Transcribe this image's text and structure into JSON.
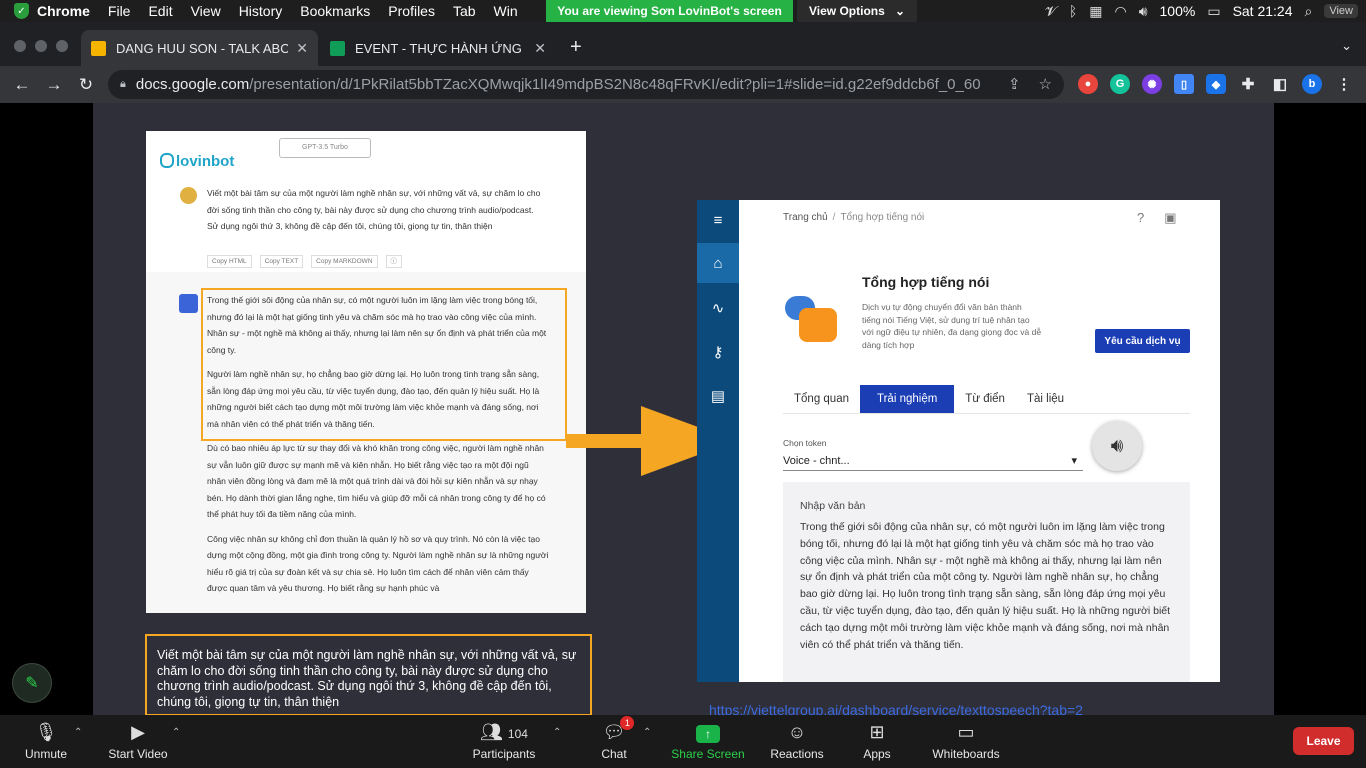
{
  "menubar": {
    "app": "Chrome",
    "items": [
      "File",
      "Edit",
      "View",
      "History",
      "Bookmarks",
      "Profiles",
      "Tab",
      "Win"
    ],
    "banner": "You are viewing Sơn LovinBot's screen",
    "view_options": "View Options",
    "battery": "100%",
    "clock": "Sat 21:24",
    "view": "View"
  },
  "tabs": [
    {
      "title": "DANG HUU SON - TALK ABOU",
      "favicon_color": "#f4b400"
    },
    {
      "title": "EVENT - THỰC HÀNH ỨNG DU",
      "favicon_color": "#0f9d58"
    }
  ],
  "toolbar": {
    "url_host": "docs.google.com",
    "url_path": "/presentation/d/1PkRilat5bbTZacXQMwqjk1lI49mdpBS2N8c48qFRvKI/edit?pli=1#slide=id.g22ef9ddcb6f_0_60"
  },
  "chat": {
    "model": "GPT-3.5 Turbo",
    "logo": "lovinbot",
    "prompt": "Viết một bài tâm sự của một người làm nghề nhân sự, với những vất vả, sự chăm lo cho đời sống tinh thần cho công ty, bài này được sử dụng cho chương trình audio/podcast. Sử dụng ngôi thứ 3, không đề cập đến tôi, chúng tôi, giọng tự tin, thân thiện",
    "copy_buttons": [
      "Copy HTML",
      "Copy TEXT",
      "Copy MARKDOWN"
    ],
    "answer": [
      "Trong thế giới sôi động của nhân sự, có một người luôn im lặng làm việc trong bóng tối, nhưng đó lại là một hạt giống tinh yêu và chăm sóc mà họ trao vào công việc của mình. Nhân sự - một nghề mà không ai thấy, nhưng lại làm nên sự ổn định và phát triển của một công ty.",
      "Người làm nghề nhân sự, họ chẳng bao giờ dừng lại. Họ luôn trong tình trạng sẵn sàng, sẵn lòng đáp ứng mọi yêu cầu, từ việc tuyển dụng, đào tạo, đến quản lý hiệu suất. Họ là những người biết cách tạo dựng một môi trường làm việc khỏe mạnh và đáng sống, nơi mà nhân viên có thể phát triển và thăng tiến.",
      "Dù có bao nhiêu áp lực từ sự thay đổi và khó khăn trong công việc, người làm nghề nhân sự vẫn luôn giữ được sự mạnh mẽ và kiên nhẫn. Họ biết rằng việc tạo ra một đội ngũ nhân viên đồng lòng và đam mê là một quá trình dài và đòi hỏi sự kiên nhẫn và sự nhạy bén. Họ dành thời gian lắng nghe, tìm hiểu và giúp đỡ mỗi cá nhân trong công ty để họ có thể phát huy tối đa tiềm năng của mình.",
      "Công việc nhân sự không chỉ đơn thuần là quản lý hồ sơ và quy trình. Nó còn là việc tạo dựng một cộng đồng, một gia đình trong công ty. Người làm nghề nhân sự là những người hiểu rõ giá trị của sự đoàn kết và sự chia sẻ. Họ luôn tìm cách để nhân viên cảm thấy được quan tâm và yêu thương. Họ biết rằng sự hạnh phúc và"
    ]
  },
  "prompt_box": "Viết một bài tâm sự của một người làm nghề nhân sự, với những vất vả, sự chăm lo cho đời sống tinh thần cho công ty, bài này được sử dụng cho chương trình audio/podcast. Sử dụng ngôi thứ 3, không đề cập đến tôi, chúng tôi, giọng tự tin, thân thiện",
  "tts": {
    "breadcrumb_home": "Trang chủ",
    "breadcrumb_current": "Tổng hợp tiếng nói",
    "title": "Tổng hợp tiếng nói",
    "description": "Dịch vụ tự động chuyển đổi văn bản thành tiếng nói Tiếng Việt, sử dụng trí tuệ nhân tạo với ngữ điệu tự nhiên, đa dạng giọng đọc và dễ dàng tích hợp",
    "request_button": "Yêu cầu dịch vụ",
    "tabs": [
      "Tổng quan",
      "Trải nghiệm",
      "Từ điển",
      "Tài liệu"
    ],
    "active_tab": "Trải nghiệm",
    "token_label": "Chọn token",
    "token_value": "Voice - chnt...",
    "text_label": "Nhập văn bản",
    "text_body": "Trong thế giới sôi động của nhân sự, có một người luôn im lặng làm việc trong bóng tối, nhưng đó lại là một hạt giống tinh yêu và chăm sóc mà họ trao vào công việc của mình. Nhân sự - một nghề mà không ai thấy, nhưng lại làm nên sự ổn định và phát triển của một công ty. Người làm nghề nhân sự, họ chẳng bao giờ dừng lại. Họ luôn trong tình trạng sẵn sàng, sẵn lòng đáp ứng mọi yêu cầu, từ việc tuyển dụng, đào tạo, đến quản lý hiệu suất. Họ là những người biết cách tạo dựng một môi trường làm việc khỏe mạnh và đáng sống, nơi mà nhân viên có thể phát triển và thăng tiến."
  },
  "footer_url": "https://viettelgroup.ai/dashboard/service/texttospeech?tab=2",
  "zoom": {
    "unmute": "Unmute",
    "start_video": "Start Video",
    "participants": "Participants",
    "participants_count": "104",
    "chat": "Chat",
    "chat_badge": "1",
    "share_screen": "Share Screen",
    "reactions": "Reactions",
    "apps": "Apps",
    "whiteboards": "Whiteboards",
    "leave": "Leave"
  }
}
